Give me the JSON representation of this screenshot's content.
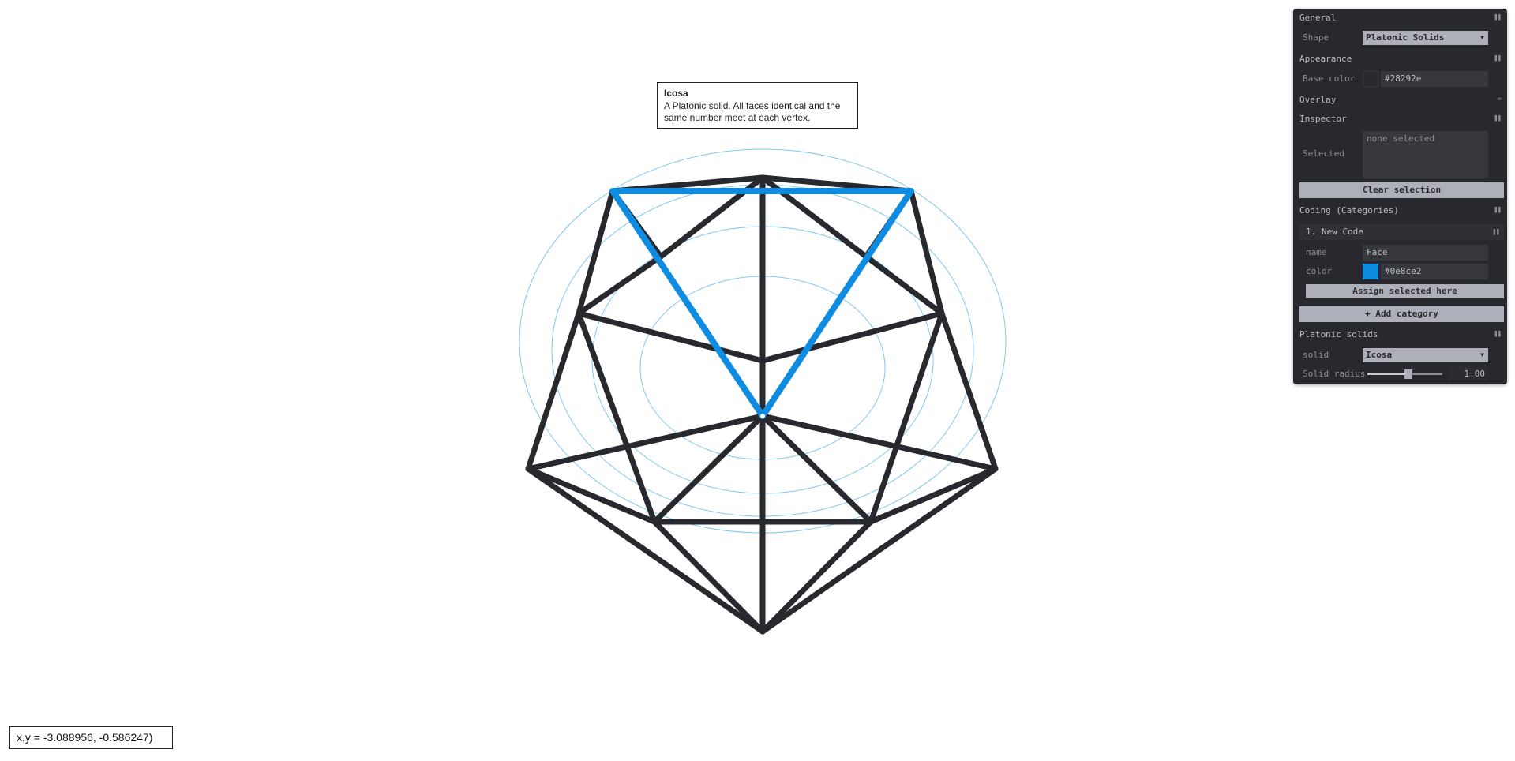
{
  "tooltip": {
    "title": "Icosa",
    "description": "A Platonic solid. All faces identical and the same number meet at each vertex."
  },
  "readout": {
    "text": "x,y = -3.088956, -0.586247)"
  },
  "colors": {
    "base_line": "#28292e",
    "face_highlight": "#0e8ce2",
    "overlay_rings": "#7fc8f0",
    "panel_bg": "#28292e"
  },
  "panel": {
    "general": {
      "title": "General",
      "shape_label": "Shape",
      "shape_value": "Platonic Solids"
    },
    "appearance": {
      "title": "Appearance",
      "base_color_label": "Base color",
      "base_color_value": "#28292e"
    },
    "overlay": {
      "title": "Overlay"
    },
    "inspector": {
      "title": "Inspector",
      "selected_label": "Selected",
      "selected_value": "none selected",
      "clear_button": "Clear selection"
    },
    "coding": {
      "title": "Coding (Categories)",
      "category": {
        "title": "1. New Code",
        "name_label": "name",
        "name_value": "Face",
        "color_label": "color",
        "color_value": "#0e8ce2",
        "assign_button": "Assign selected here"
      },
      "add_button": "+ Add category"
    },
    "platonic": {
      "title": "Platonic solids",
      "solid_label": "solid",
      "solid_value": "Icosa",
      "radius_label": "Solid radius",
      "radius_value": "1.00",
      "radius_fraction": 0.55
    }
  }
}
